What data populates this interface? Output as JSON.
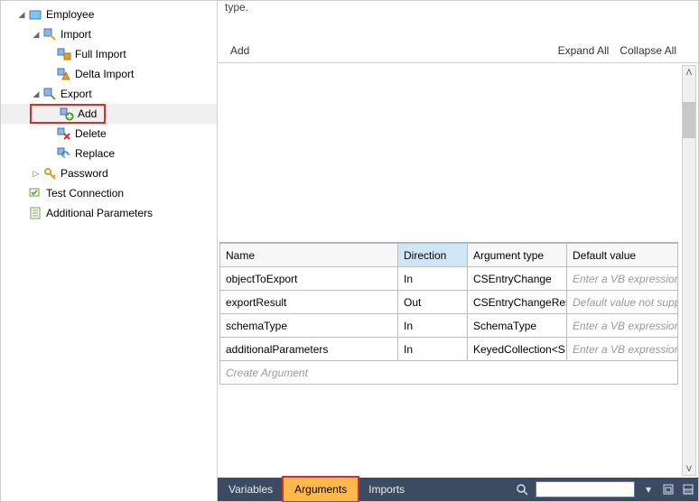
{
  "top_fragment": "type.",
  "toolbar": {
    "add": "Add",
    "expand_all": "Expand All",
    "collapse_all": "Collapse All"
  },
  "tree": {
    "employee": "Employee",
    "import": "Import",
    "full_import": "Full Import",
    "delta_import": "Delta Import",
    "export": "Export",
    "add": "Add",
    "delete": "Delete",
    "replace": "Replace",
    "password": "Password",
    "test_connection": "Test Connection",
    "additional_parameters": "Additional Parameters"
  },
  "args_table": {
    "headers": {
      "name": "Name",
      "direction": "Direction",
      "arg_type": "Argument type",
      "default": "Default value"
    },
    "rows": [
      {
        "name": "objectToExport",
        "direction": "In",
        "arg_type": "CSEntryChange",
        "default": "Enter a VB expression",
        "default_placeholder": true
      },
      {
        "name": "exportResult",
        "direction": "Out",
        "arg_type": "CSEntryChangeRes",
        "default": "Default value not suppor",
        "default_placeholder": true
      },
      {
        "name": "schemaType",
        "direction": "In",
        "arg_type": "SchemaType",
        "default": "Enter a VB expression",
        "default_placeholder": true
      },
      {
        "name": "additionalParameters",
        "direction": "In",
        "arg_type": "KeyedCollection<S",
        "default": "Enter a VB expression",
        "default_placeholder": true
      }
    ],
    "create_row": "Create Argument"
  },
  "bottom": {
    "variables": "Variables",
    "arguments": "Arguments",
    "imports": "Imports"
  }
}
